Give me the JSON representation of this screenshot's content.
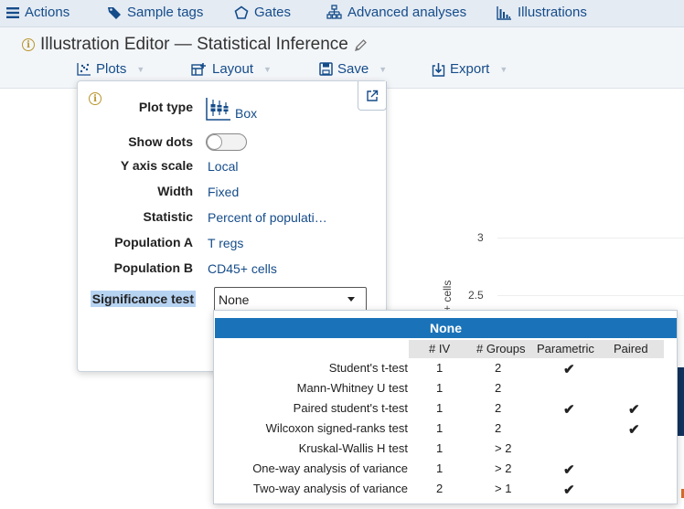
{
  "nav": {
    "items": [
      {
        "label": "Actions",
        "icon": "hamburger-icon"
      },
      {
        "label": "Sample tags",
        "icon": "tag-icon"
      },
      {
        "label": "Gates",
        "icon": "pentagon-icon"
      },
      {
        "label": "Advanced analyses",
        "icon": "hierarchy-icon"
      },
      {
        "label": "Illustrations",
        "icon": "histogram-icon"
      }
    ]
  },
  "header": {
    "title": "Illustration Editor — Statistical Inference",
    "toolbar": [
      {
        "label": "Plots",
        "icon": "scatter-icon"
      },
      {
        "label": "Layout",
        "icon": "layout-icon"
      },
      {
        "label": "Save",
        "icon": "save-icon"
      },
      {
        "label": "Export",
        "icon": "export-icon"
      }
    ]
  },
  "panel": {
    "rows": [
      {
        "label": "Plot type",
        "value": "Box"
      },
      {
        "label": "Show dots",
        "value": ""
      },
      {
        "label": "Y axis scale",
        "value": "Local"
      },
      {
        "label": "Width",
        "value": "Fixed"
      },
      {
        "label": "Statistic",
        "value": "Percent of populati…"
      },
      {
        "label": "Population A",
        "value": "T regs"
      },
      {
        "label": "Population B",
        "value": "CD45+ cells"
      }
    ],
    "significance_label": "Significance test",
    "significance_value": "None",
    "show_dots": false
  },
  "dropdown": {
    "selected": "None",
    "columns": [
      "# IV",
      "# Groups",
      "Parametric",
      "Paired"
    ],
    "check_glyph": "✔",
    "rows": [
      {
        "name": "Student's t-test",
        "iv": "1",
        "groups": "2",
        "parametric": true,
        "paired": false
      },
      {
        "name": "Mann-Whitney U test",
        "iv": "1",
        "groups": "2",
        "parametric": false,
        "paired": false
      },
      {
        "name": "Paired student's t-test",
        "iv": "1",
        "groups": "2",
        "parametric": true,
        "paired": true
      },
      {
        "name": "Wilcoxon signed-ranks test",
        "iv": "1",
        "groups": "2",
        "parametric": false,
        "paired": true
      },
      {
        "name": "Kruskal-Wallis H test",
        "iv": "1",
        "groups": "> 2",
        "parametric": false,
        "paired": false
      },
      {
        "name": "One-way analysis of variance",
        "iv": "1",
        "groups": "> 2",
        "parametric": true,
        "paired": false
      },
      {
        "name": "Two-way analysis of variance",
        "iv": "2",
        "groups": "> 1",
        "parametric": true,
        "paired": false
      }
    ]
  },
  "chart": {
    "yticks": [
      "3",
      "2.5"
    ],
    "ylabel": "+ cells"
  },
  "colors": {
    "link": "#154c8a",
    "accent": "#1a73b8",
    "info": "#b8952c"
  }
}
